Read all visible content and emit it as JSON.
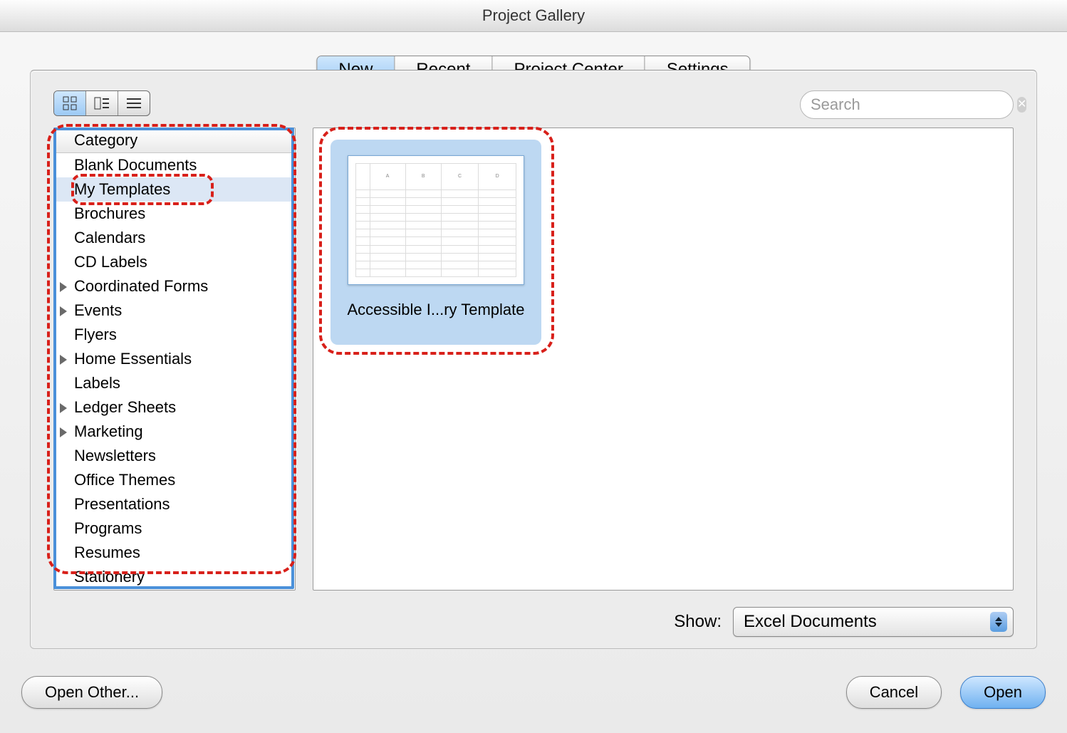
{
  "window": {
    "title": "Project Gallery"
  },
  "tabs": [
    {
      "label": "New",
      "active": true
    },
    {
      "label": "Recent",
      "active": false
    },
    {
      "label": "Project Center",
      "active": false
    },
    {
      "label": "Settings",
      "active": false
    }
  ],
  "view_buttons": [
    {
      "name": "view-grid-icon",
      "active": true
    },
    {
      "name": "view-columns-icon",
      "active": false
    },
    {
      "name": "view-list-icon",
      "active": false
    }
  ],
  "search": {
    "placeholder": "Search",
    "value": ""
  },
  "sidebar": {
    "header": "Category",
    "items": [
      {
        "label": "Blank Documents",
        "expandable": false,
        "selected": false
      },
      {
        "label": "My Templates",
        "expandable": false,
        "selected": true
      },
      {
        "label": "Brochures",
        "expandable": false,
        "selected": false
      },
      {
        "label": "Calendars",
        "expandable": false,
        "selected": false
      },
      {
        "label": "CD Labels",
        "expandable": false,
        "selected": false
      },
      {
        "label": "Coordinated Forms",
        "expandable": true,
        "selected": false
      },
      {
        "label": "Events",
        "expandable": true,
        "selected": false
      },
      {
        "label": "Flyers",
        "expandable": false,
        "selected": false
      },
      {
        "label": "Home Essentials",
        "expandable": true,
        "selected": false
      },
      {
        "label": "Labels",
        "expandable": false,
        "selected": false
      },
      {
        "label": "Ledger Sheets",
        "expandable": true,
        "selected": false
      },
      {
        "label": "Marketing",
        "expandable": true,
        "selected": false
      },
      {
        "label": "Newsletters",
        "expandable": false,
        "selected": false
      },
      {
        "label": "Office Themes",
        "expandable": false,
        "selected": false
      },
      {
        "label": "Presentations",
        "expandable": false,
        "selected": false
      },
      {
        "label": "Programs",
        "expandable": false,
        "selected": false
      },
      {
        "label": "Resumes",
        "expandable": false,
        "selected": false
      },
      {
        "label": "Stationery",
        "expandable": false,
        "selected": false
      }
    ]
  },
  "templates": [
    {
      "label": "Accessible I...ry Template",
      "selected": true,
      "preview_columns": [
        "A",
        "B",
        "C",
        "D"
      ]
    }
  ],
  "show": {
    "label": "Show:",
    "value": "Excel Documents"
  },
  "buttons": {
    "open_other": "Open Other...",
    "cancel": "Cancel",
    "open": "Open"
  }
}
